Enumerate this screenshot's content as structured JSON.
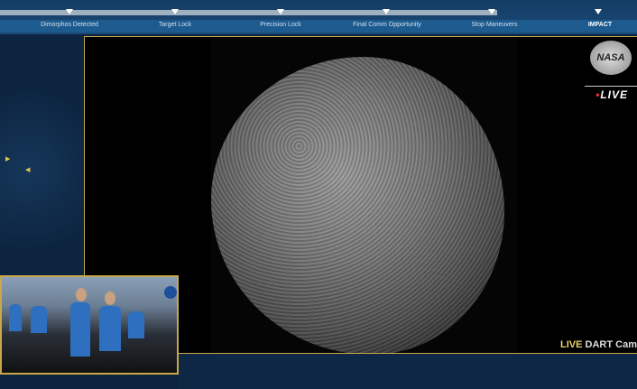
{
  "timeline": {
    "milestones": [
      "Dimorphos Detected",
      "Target Lock",
      "Precision Lock",
      "Final Comm Opportunity",
      "Stop Maneuvers",
      "IMPACT"
    ],
    "progress_percent": 78
  },
  "video": {
    "logo_text": "NASA",
    "live_badge": "LIVE",
    "camera_live": "LIVE",
    "camera_name": "DART Cam"
  },
  "colors": {
    "accent": "#c9a84a",
    "live": "#e8d36a",
    "nav": "#1d5a8e"
  }
}
